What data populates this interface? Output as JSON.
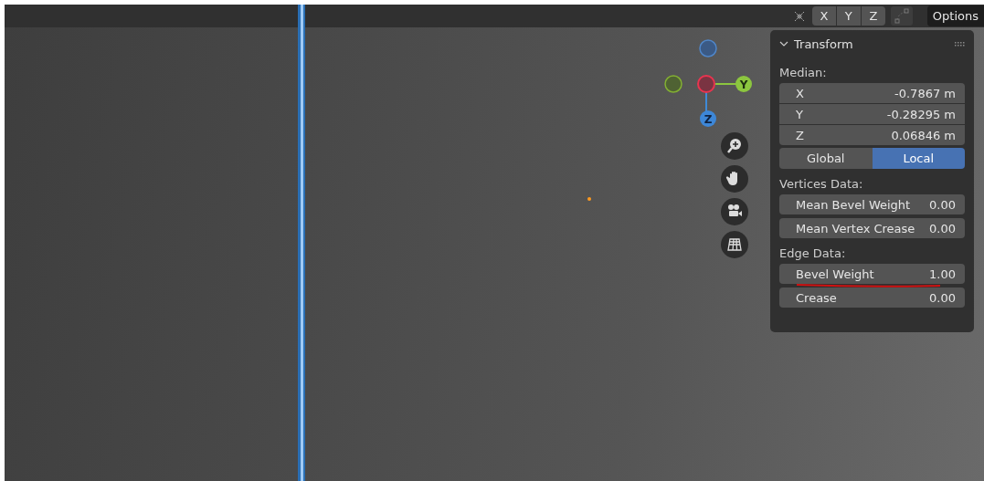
{
  "header": {
    "axis_buttons": [
      {
        "label": "X"
      },
      {
        "label": "Y"
      },
      {
        "label": "Z"
      }
    ],
    "options": "Options"
  },
  "gizmo": {
    "y_label": "Y",
    "z_label": "Z"
  },
  "panel": {
    "title": "Transform",
    "median_label": "Median:",
    "median_fields": [
      {
        "label": "X",
        "value": "-0.7867 m"
      },
      {
        "label": "Y",
        "value": "-0.28295 m"
      },
      {
        "label": "Z",
        "value": "0.06846 m"
      }
    ],
    "space_tabs": [
      {
        "label": "Global",
        "selected": false
      },
      {
        "label": "Local",
        "selected": true
      }
    ],
    "vertices_label": "Vertices Data:",
    "vertices_fields": [
      {
        "label": "Mean Bevel Weight",
        "value": "0.00"
      },
      {
        "label": "Mean Vertex Crease",
        "value": "0.00"
      }
    ],
    "edge_label": "Edge Data:",
    "edge_fields": [
      {
        "label": "Bevel Weight",
        "value": "1.00",
        "underlined": true
      },
      {
        "label": "Crease",
        "value": "0.00",
        "underlined": false
      }
    ]
  }
}
